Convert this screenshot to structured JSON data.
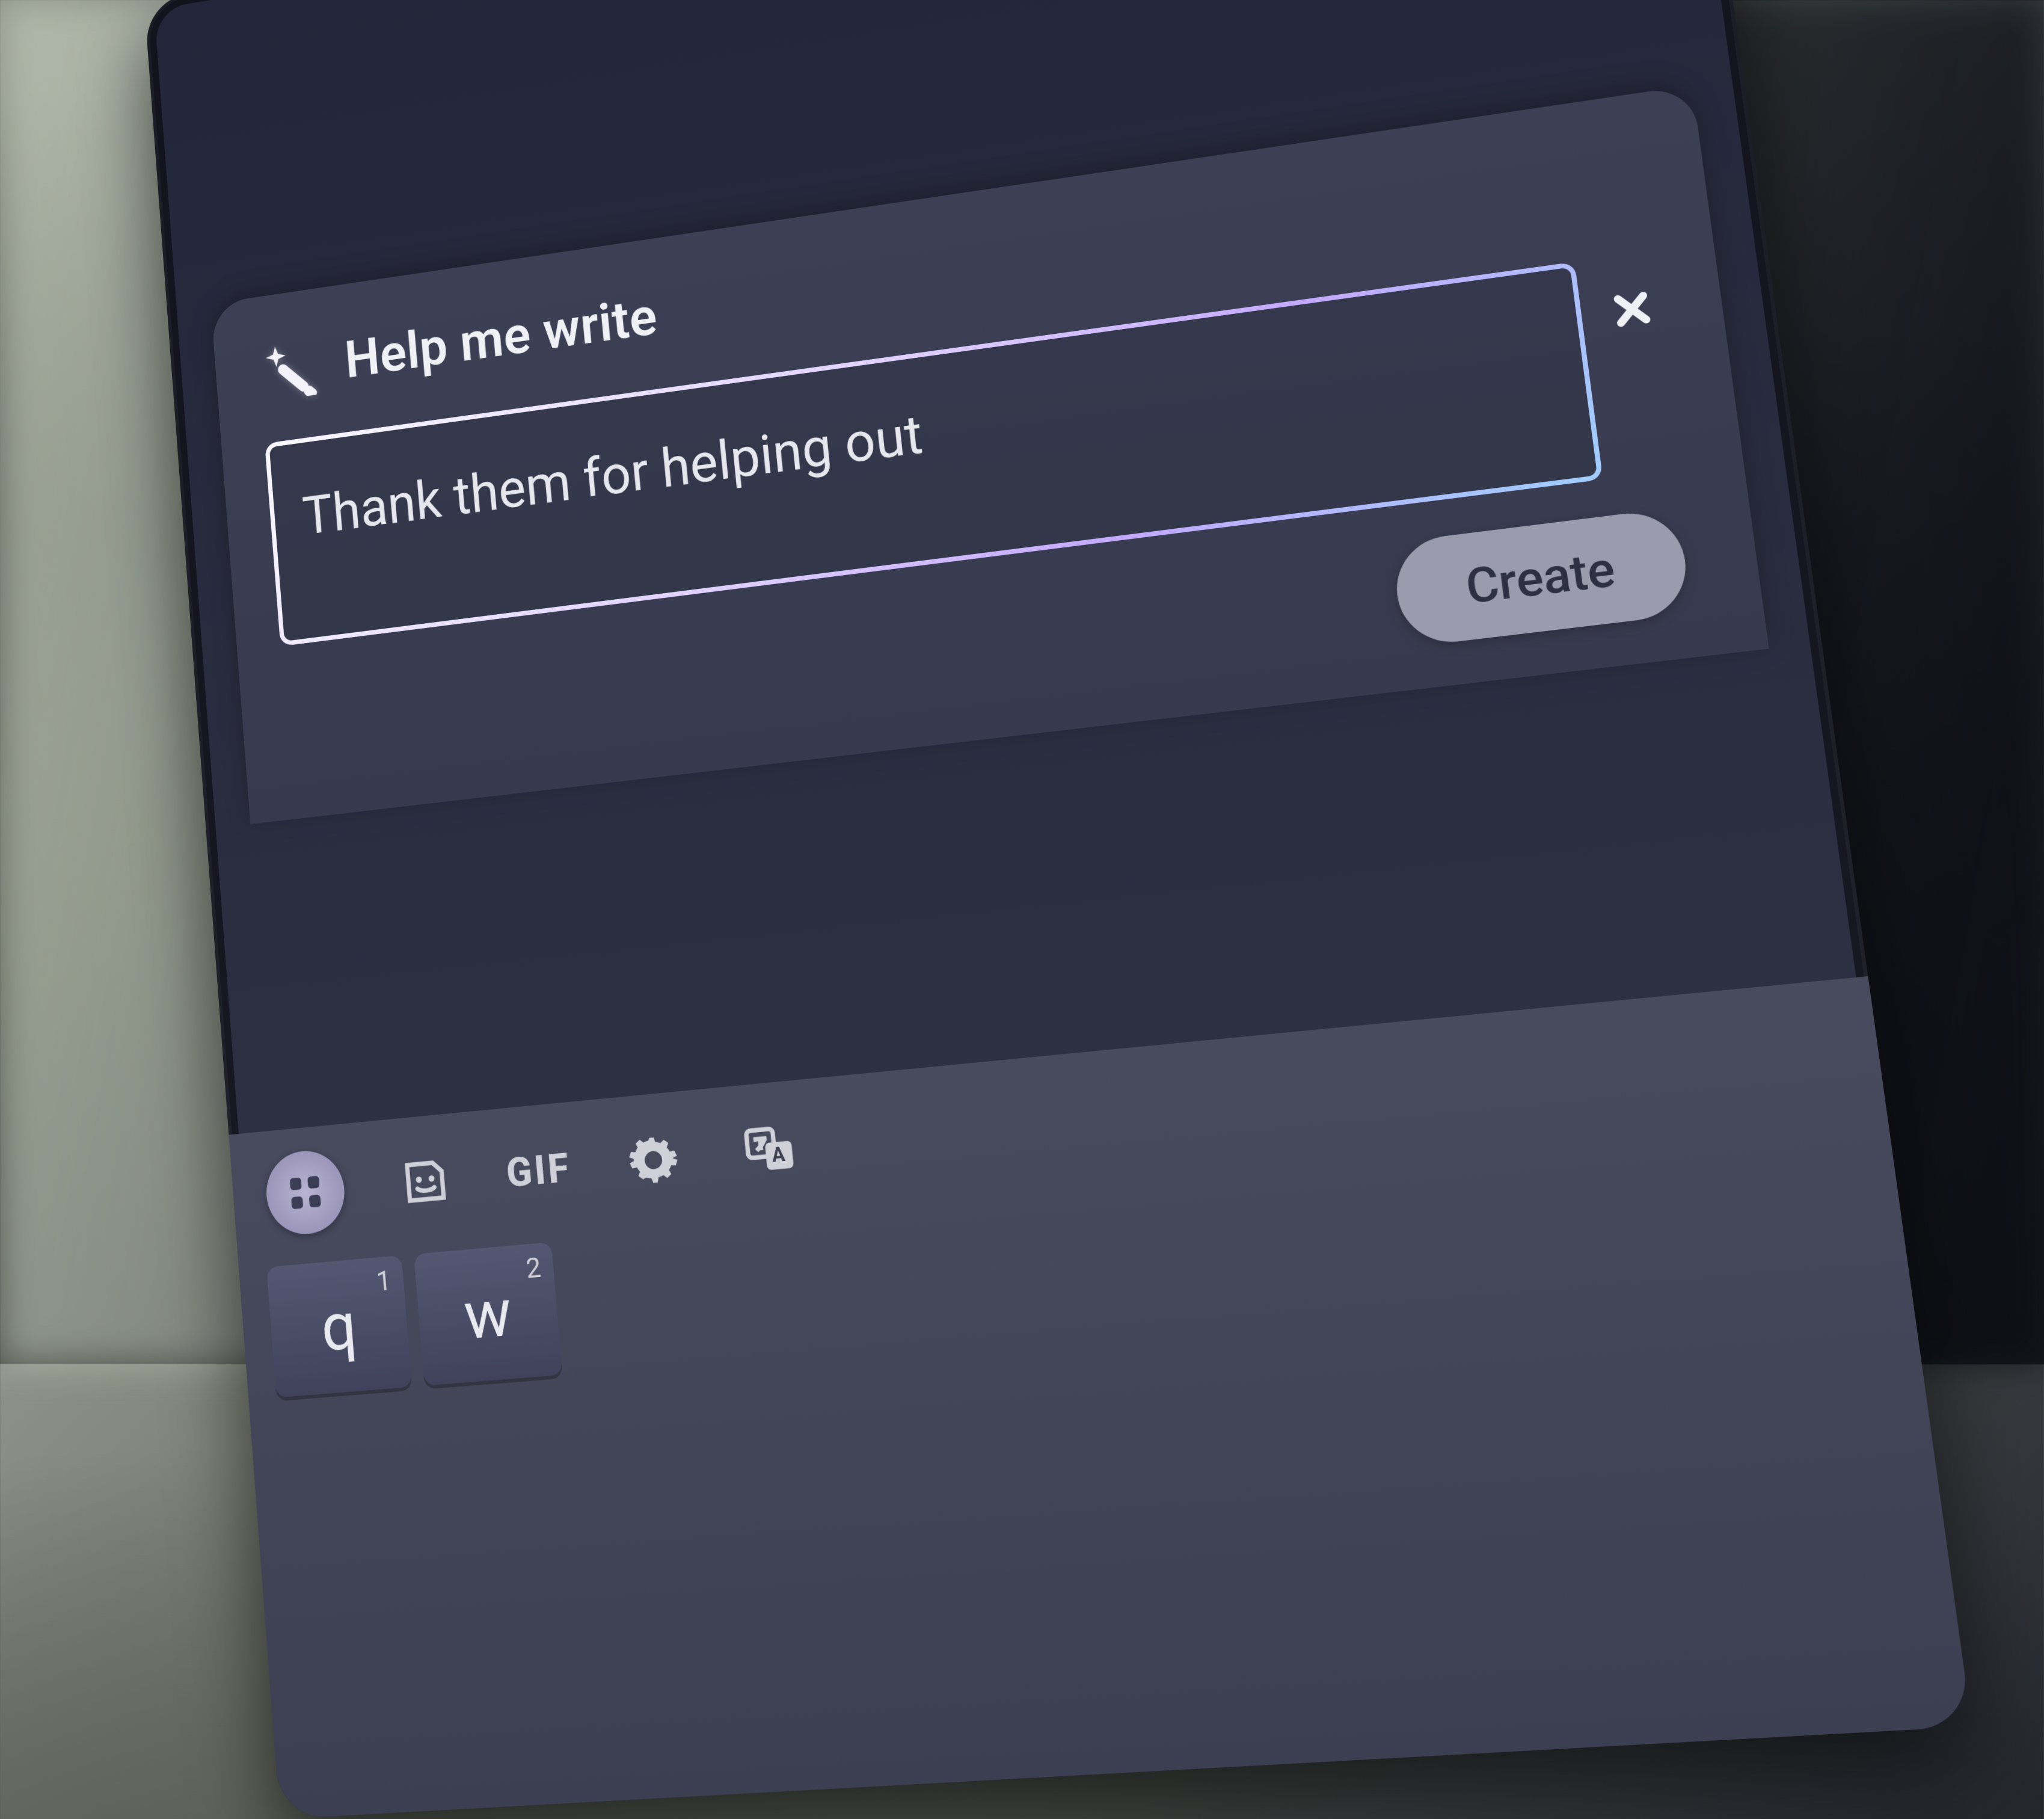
{
  "card": {
    "title": "Help me write",
    "icon": "magic-pen-icon"
  },
  "prompt": {
    "value": "Thank them for helping out",
    "close_icon": "close-icon"
  },
  "actions": {
    "create_label": "Create"
  },
  "keyboard": {
    "toolbar": {
      "apps_icon": "apps-grid-icon",
      "sticker_icon": "sticker-icon",
      "gif_label": "GIF",
      "settings_icon": "gear-icon",
      "translate_icon": "translate-icon"
    },
    "row1": [
      {
        "main": "q",
        "sup": "1"
      },
      {
        "main": "w",
        "sup": "2"
      }
    ]
  }
}
